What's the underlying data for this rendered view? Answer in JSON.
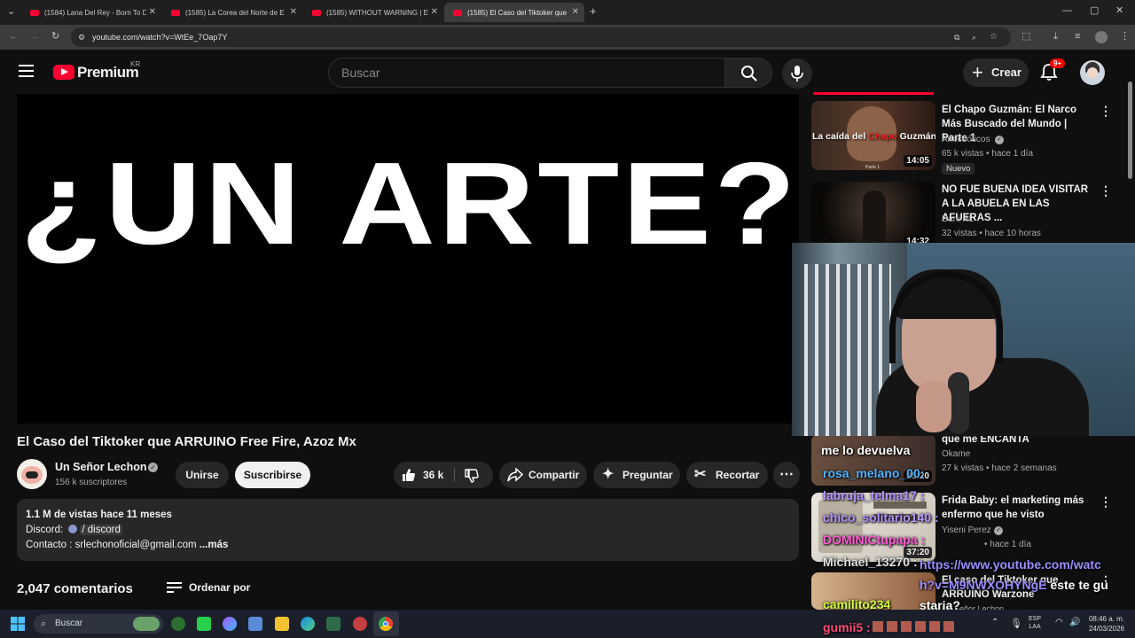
{
  "browser": {
    "tabs": [
      {
        "title": "(1584) Lana Del Rey - Born To D",
        "active": false
      },
      {
        "title": "(1585) La Corea del Norte de E",
        "active": false
      },
      {
        "title": "(1585) WITHOUT WARNING | E",
        "active": false
      },
      {
        "title": "(1585) El Caso del Tiktoker que",
        "active": true
      }
    ],
    "url": "youtube.com/watch?v=WtEe_7Oap7Y"
  },
  "masthead": {
    "logo_text": "Premium",
    "region": "KR",
    "search_placeholder": "Buscar",
    "create_label": "Crear",
    "notification_count": "9+"
  },
  "video": {
    "overlay_text": "¿UN ARTE?",
    "title": "El Caso del Tiktoker que ARRUINO Free Fire, Azoz Mx",
    "channel": "Un Señor Lechon",
    "subscribers": "156 k suscriptores",
    "join_label": "Unirse",
    "subscribe_label": "Suscribirse",
    "likes": "36 k",
    "share_label": "Compartir",
    "ask_label": "Preguntar",
    "clip_label": "Recortar"
  },
  "description": {
    "stats": "1.1 M de vistas  hace 11 meses",
    "discord_prefix": "Discord:",
    "discord_link": "/ discord",
    "contact": "Contacto : srlechonoficial@gmail.com",
    "more": "...más"
  },
  "comments": {
    "count_label": "2,047 comentarios",
    "sort_label": "Ordenar por"
  },
  "sidebar": {
    "items": [
      {
        "title": "El Chapo Guzmán: El Narco Más Buscado del Mundo | Parte 1",
        "channel": "Anecdóticos",
        "meta": "65 k vistas • hace 1 día",
        "badge": "Nuevo",
        "duration": "14:05",
        "thumb_text_a": "La caída del",
        "thumb_text_b": "Chapo",
        "thumb_text_c": "Guzmán",
        "thumb_sub": "Parte 1"
      },
      {
        "title": "NO FUE BUENA IDEA VISITAR A LA ABUELA EN LAS AFUERAS ...",
        "channel": "Dani RL",
        "meta": "32 vistas • hace 10 horas",
        "duration": "14:32"
      },
      {
        "title": "que me ENCANTA",
        "channel": "",
        "meta": "27 k vistas • hace 2 semanas",
        "duration": "35:20"
      },
      {
        "title": "Frida Baby: el marketing más enfermo que he visto",
        "channel": "Yiseni Perez",
        "meta": "• hace 1 día",
        "duration": "37:20"
      },
      {
        "title": "El caso del Tiktoker que ARRUINO Warzone",
        "channel": "Un Señor Lechon",
        "meta": "",
        "duration": ""
      }
    ],
    "okame": "Okame"
  },
  "chat": [
    {
      "user": "me lo devuelva",
      "color": "#ffffff"
    },
    {
      "user": "rosa_melano_00:",
      "color": "#4fb3ff"
    },
    {
      "user": "labruja_telma17 :",
      "color": "#b592ff"
    },
    {
      "user": "chico_solitario140 :",
      "color": "#b592ff"
    },
    {
      "user": "DOMINICtupapa :",
      "color": "#ff5ad1"
    },
    {
      "user": "Michael_13270 :",
      "color": "#e0e0e0"
    },
    {
      "text": "https://www.youtube.com/watch?v=M9NWXOHYNgE",
      "color": "#9b8cff"
    },
    {
      "text": "este te gustaria?",
      "color": "#ffffff"
    },
    {
      "user": "camilito234",
      "color": "#d2ff3c"
    },
    {
      "user": "gumii5 :",
      "color": "#ff4d7a"
    }
  ],
  "taskbar": {
    "search_placeholder": "Buscar",
    "lang_top": "ESP",
    "lang_bottom": "LAA",
    "time": "08:46 a. m.",
    "date": "24/03/2026"
  }
}
